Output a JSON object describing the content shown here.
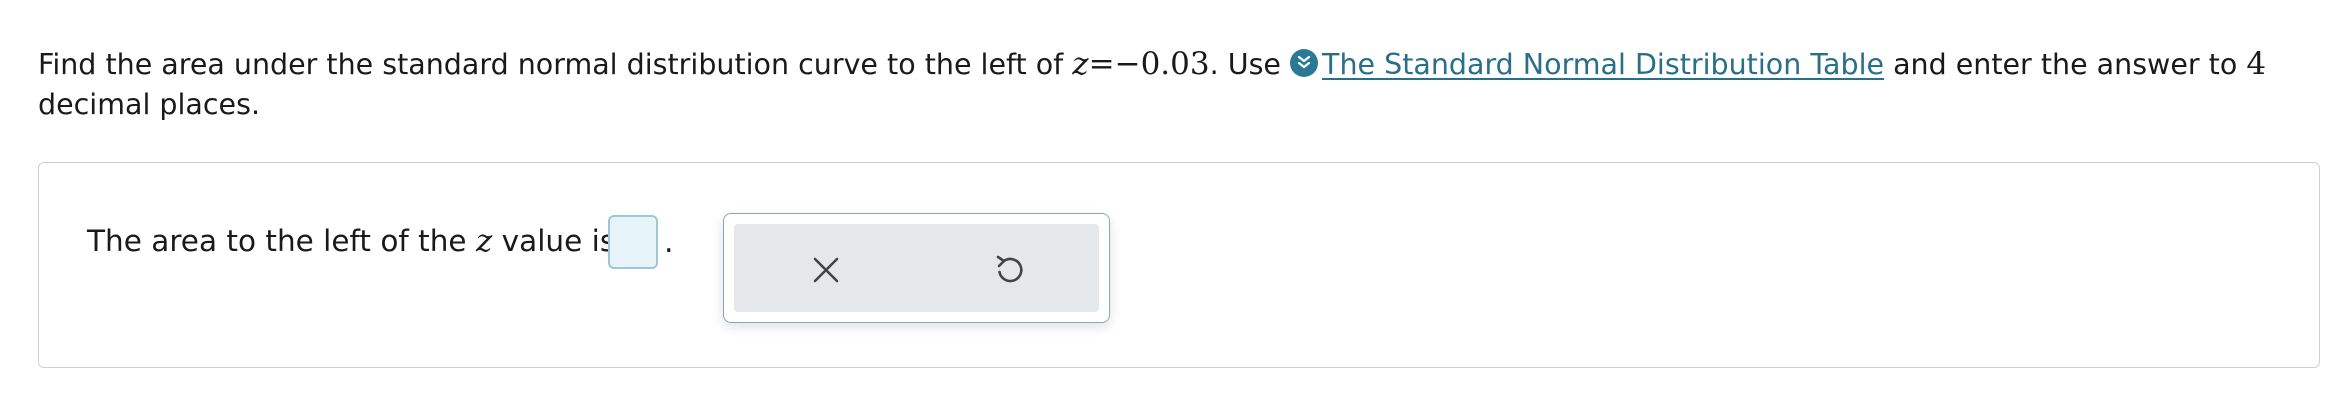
{
  "question": {
    "prefix": "Find the area under the standard normal distribution curve to the left of ",
    "z_symbol": "z",
    "equals": "=",
    "z_value": "−0.03",
    "after_value": ". Use ",
    "link_text": "The Standard Normal Distribution Table",
    "suffix_before_digits": " and enter the answer to ",
    "decimal_digits": "4",
    "suffix_end": "decimal places."
  },
  "answer": {
    "prompt_before": "The area to the left of the ",
    "z_symbol": "z",
    "prompt_after": " value is",
    "input_value": "",
    "period": "."
  },
  "toolbar": {
    "clear_icon": "close-icon",
    "undo_icon": "undo-icon"
  },
  "colors": {
    "link": "#2a6f8a",
    "info_icon_bg": "#2a7a96",
    "input_bg": "#e6f4fa",
    "input_border": "#9ec5d9",
    "toolbar_bg": "#e4e8ea"
  }
}
